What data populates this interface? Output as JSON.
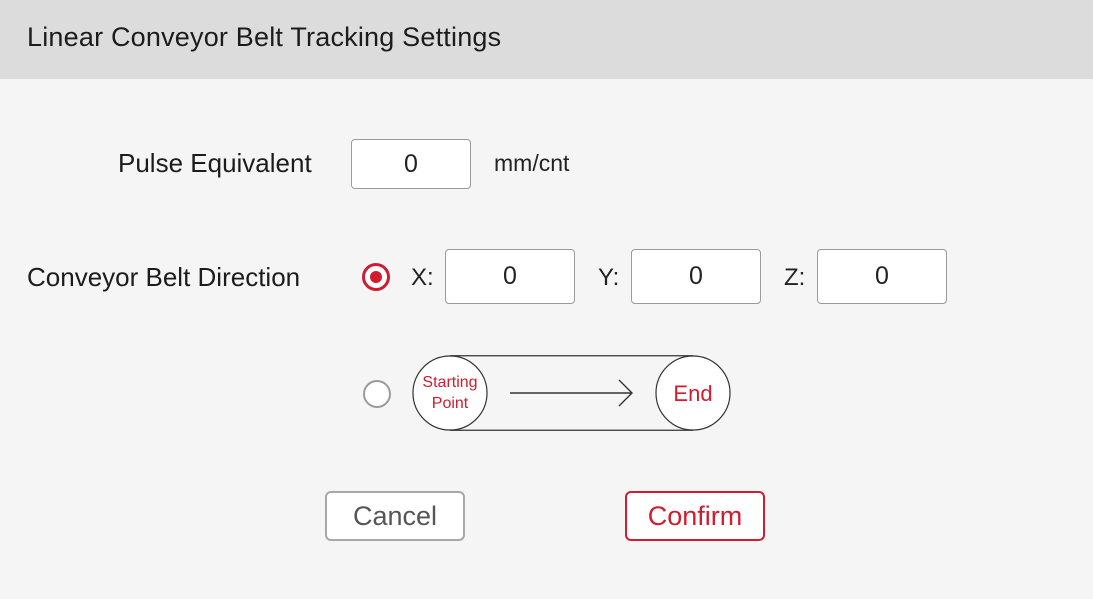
{
  "dialog": {
    "title": "Linear Conveyor Belt Tracking Settings"
  },
  "pulse": {
    "label": "Pulse Equivalent",
    "value": "0",
    "unit": "mm/cnt"
  },
  "direction": {
    "label": "Conveyor Belt Direction",
    "x_label": "X:",
    "x_value": "0",
    "y_label": "Y:",
    "y_value": "0",
    "z_label": "Z:",
    "z_value": "0",
    "selected_option": "xyz"
  },
  "diagram": {
    "start_line1": "Starting",
    "start_line2": "Point",
    "end_label": "End"
  },
  "buttons": {
    "cancel": "Cancel",
    "confirm": "Confirm"
  },
  "colors": {
    "accent": "#d01c2e",
    "header_bg": "#dcdcdc",
    "body_bg": "#f5f5f5"
  }
}
